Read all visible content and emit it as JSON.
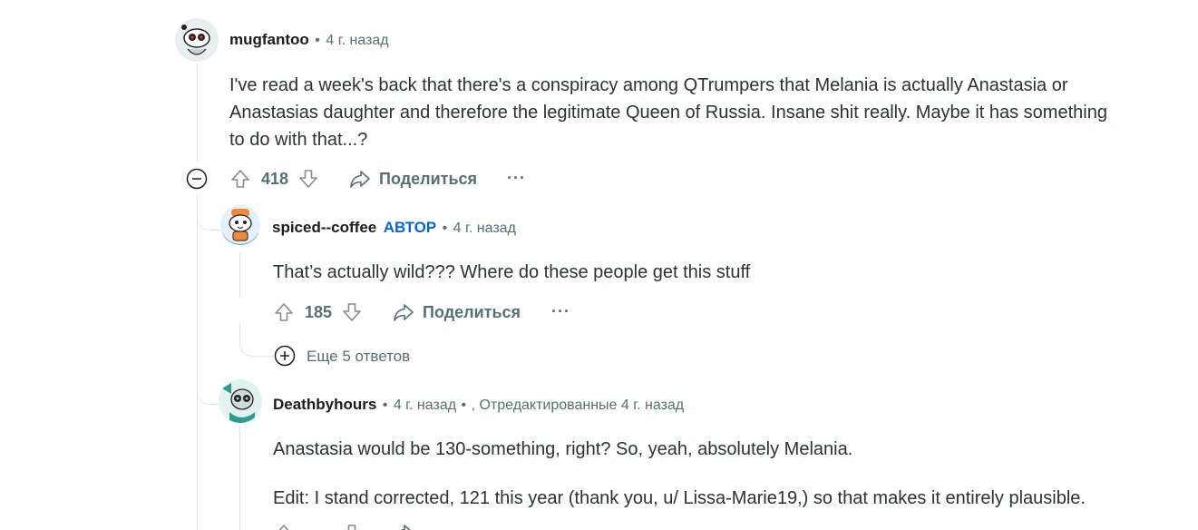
{
  "comments": [
    {
      "username": "mugfantoo",
      "time": "4 г. назад",
      "body": [
        "I've read a week's back that there's a conspiracy among QTrumpers that Melania is actually Anastasia or",
        "Anastasias daughter and therefore the legitimate Queen of Russia. Insane shit really. Maybe it has something",
        "to do with that...?"
      ],
      "votes": "418",
      "share": "Поделиться",
      "more": "···"
    },
    {
      "username": "spiced--coffee",
      "author_badge": "АВТОР",
      "time": "4 г. назад",
      "body": [
        "That’s actually wild??? Where do these people get this stuff"
      ],
      "votes": "185",
      "share": "Поделиться",
      "more": "···"
    },
    {
      "username": "Deathbyhours",
      "time": "4 г. назад",
      "edited": ", Отредактированные 4 г. назад",
      "body": [
        "Anastasia would be 130-something, right? So, yeah, absolutely Melania.",
        "Edit: I stand corrected, 121 this year (thank you, u/ Lissa-Marie19,) so that makes it entirely plausible."
      ]
    }
  ],
  "separator": "•",
  "more_replies": "Еще 5 ответов",
  "colors": {
    "author": "#0a65c9",
    "meta": "#576f76",
    "text": "#2a3236",
    "thread": "#e0e4e6"
  }
}
